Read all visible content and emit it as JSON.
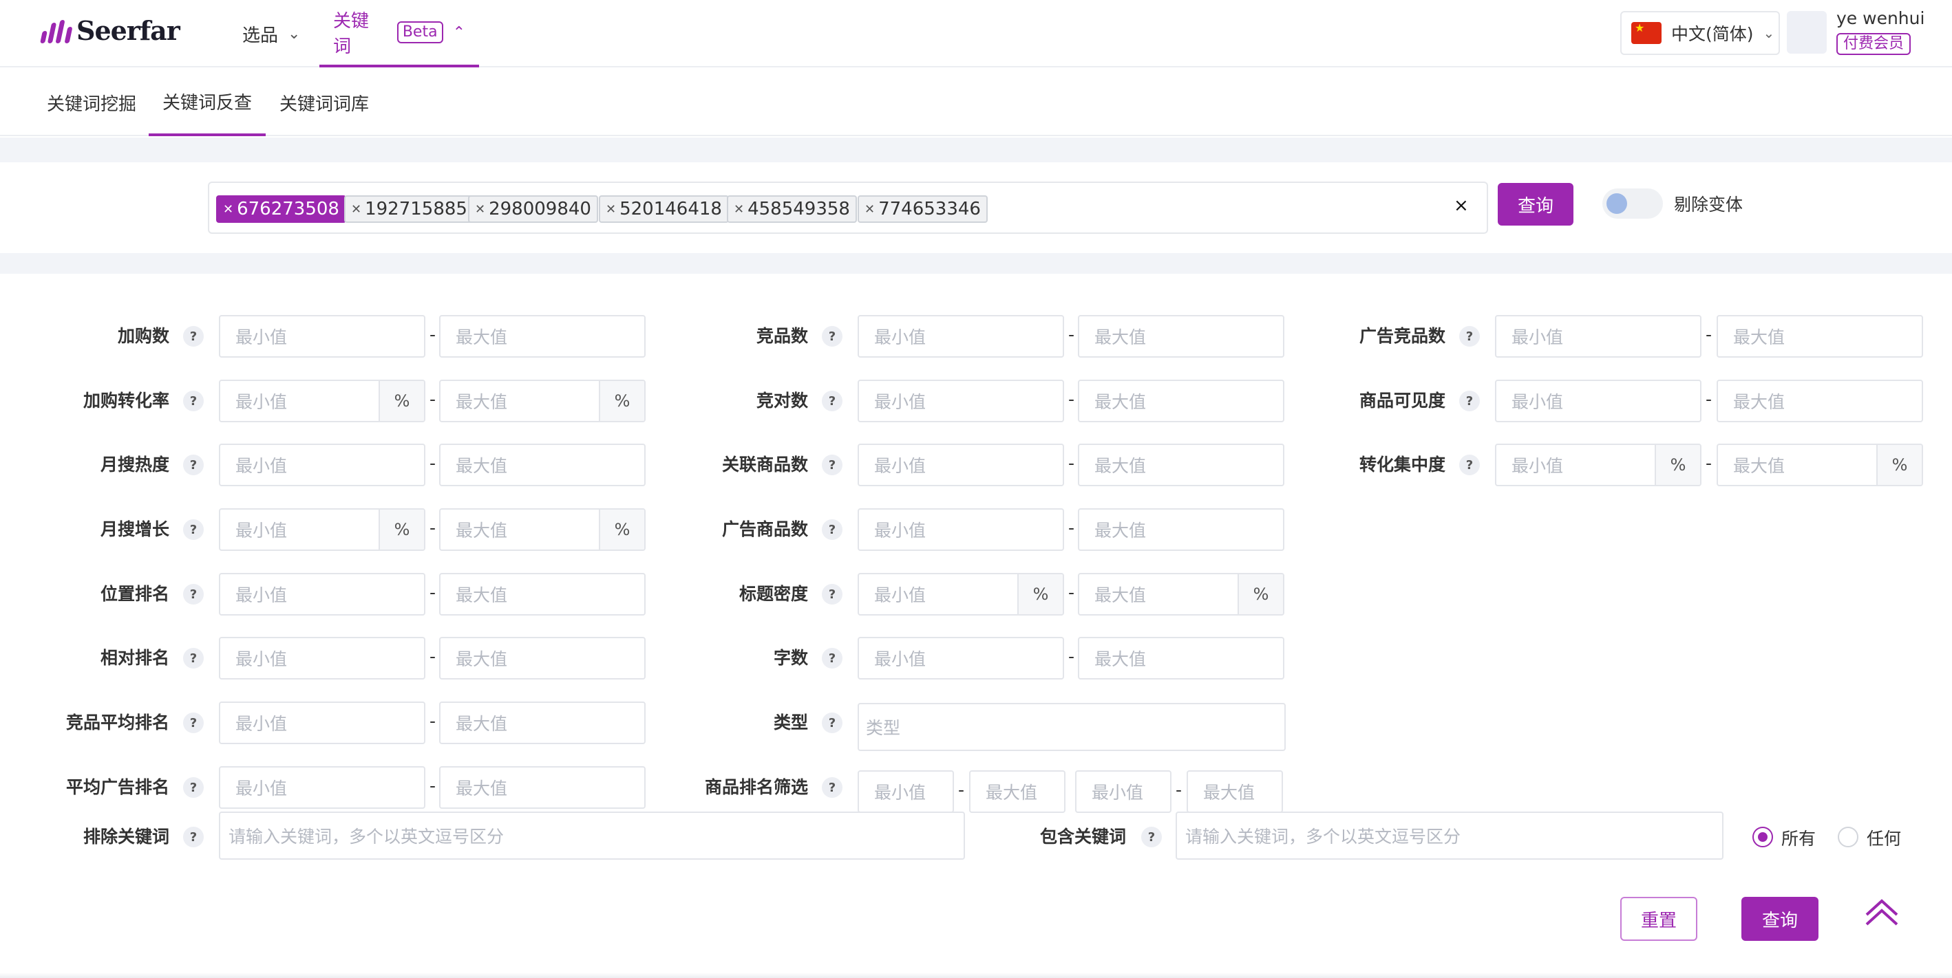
{
  "header": {
    "logo_text": "Seerfar",
    "nav": [
      {
        "label": "选品",
        "beta": ""
      },
      {
        "label": "关键词",
        "beta": "Beta"
      }
    ],
    "language": "中文(简体)",
    "username": "ye wenhui",
    "membership": "付费会员"
  },
  "tabs": [
    "关键词挖掘",
    "关键词反查",
    "关键词词库"
  ],
  "search": {
    "tags": [
      "676273508",
      "192715885",
      "298009840",
      "520146418",
      "458549358",
      "774653346"
    ],
    "clear_icon": "×",
    "button": "查询",
    "toggle_label": "剔除变体",
    "toggle_on": false
  },
  "filters": {
    "help_glyph": "?",
    "min_placeholder": "最小值",
    "max_placeholder": "最大值",
    "percent_unit": "%",
    "separator": "-",
    "col1": [
      "加购数",
      "加购转化率",
      "月搜热度",
      "月搜增长",
      "位置排名",
      "相对排名",
      "竞品平均排名",
      "平均广告排名"
    ],
    "col2": [
      "竞品数",
      "竞对数",
      "关联商品数",
      "广告商品数",
      "标题密度",
      "字数",
      "类型",
      "商品排名筛选"
    ],
    "col3": [
      "广告竞品数",
      "商品可见度",
      "转化集中度"
    ],
    "type_placeholder": "类型",
    "exclude_label": "排除关键词",
    "include_label": "包含关键词",
    "keyword_placeholder": "请输入关键词，多个以英文逗号区分",
    "match_options": [
      "所有",
      "任何"
    ],
    "match_selected": "所有"
  },
  "actions": {
    "reset": "重置",
    "query": "查询"
  },
  "colors": {
    "accent": "#9c27b0",
    "band": "#f2f4f8",
    "border": "#e3e5ea"
  },
  "icons": {
    "back_to_top": "double-chevron-up-icon"
  }
}
